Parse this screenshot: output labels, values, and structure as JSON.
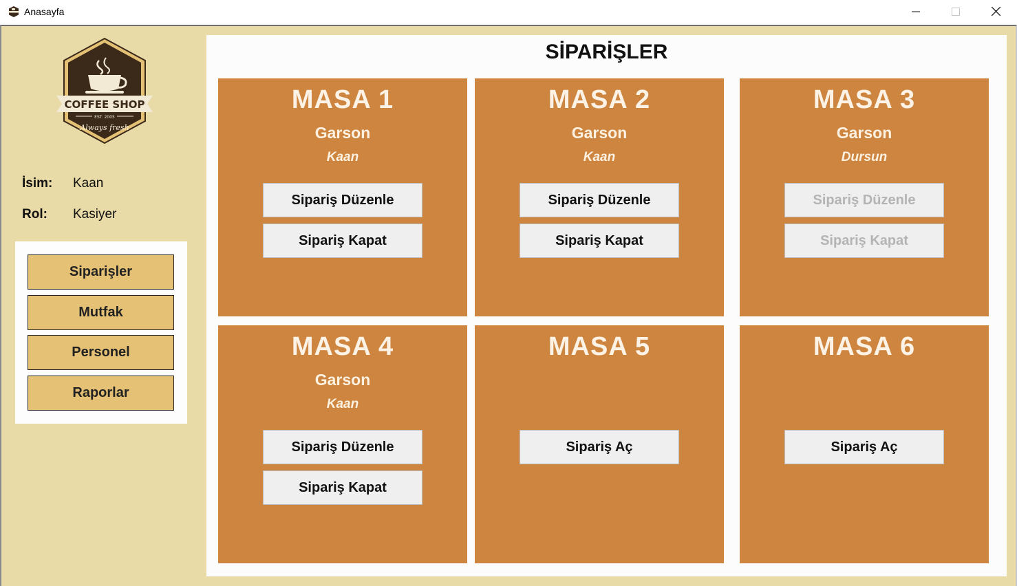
{
  "window": {
    "title": "Anasayfa",
    "icon": "coffee-shop-icon",
    "controls": {
      "minimize_icon": "minimize-icon",
      "maximize_icon": "maximize-icon",
      "close_icon": "close-icon"
    }
  },
  "logo": {
    "text_main": "COFFEE SHOP",
    "text_est": "EST. 2005",
    "text_script": "Always fresh"
  },
  "user": {
    "name_label": "İsim:",
    "name_value": "Kaan",
    "role_label": "Rol:",
    "role_value": "Kasiyer"
  },
  "nav": {
    "items": [
      {
        "label": "Siparişler"
      },
      {
        "label": "Mutfak"
      },
      {
        "label": "Personel"
      },
      {
        "label": "Raporlar"
      }
    ]
  },
  "main": {
    "title": "SİPARİŞLER",
    "tables": [
      {
        "title": "MASA 1",
        "garson_label": "Garson",
        "garson_name": "Kaan",
        "buttons": [
          {
            "label": "Sipariş Düzenle",
            "enabled": true
          },
          {
            "label": "Sipariş Kapat",
            "enabled": true
          }
        ]
      },
      {
        "title": "MASA 2",
        "garson_label": "Garson",
        "garson_name": "Kaan",
        "buttons": [
          {
            "label": "Sipariş Düzenle",
            "enabled": true
          },
          {
            "label": "Sipariş Kapat",
            "enabled": true
          }
        ]
      },
      {
        "title": "MASA 3",
        "garson_label": "Garson",
        "garson_name": "Dursun",
        "buttons": [
          {
            "label": "Sipariş Düzenle",
            "enabled": false
          },
          {
            "label": "Sipariş Kapat",
            "enabled": false
          }
        ]
      },
      {
        "title": "MASA 4",
        "garson_label": "Garson",
        "garson_name": "Kaan",
        "buttons": [
          {
            "label": "Sipariş Düzenle",
            "enabled": true
          },
          {
            "label": "Sipariş Kapat",
            "enabled": true
          }
        ]
      },
      {
        "title": "MASA 5",
        "garson_label": "",
        "garson_name": "",
        "buttons": [
          {
            "label": "Sipariş Aç",
            "enabled": true
          }
        ]
      },
      {
        "title": "MASA 6",
        "garson_label": "",
        "garson_name": "",
        "buttons": [
          {
            "label": "Sipariş Aç",
            "enabled": true
          }
        ]
      }
    ]
  },
  "colors": {
    "background": "#e8dba8",
    "card": "#cd853f",
    "nav_button": "#e4c175",
    "panel": "#fcfcfc"
  }
}
